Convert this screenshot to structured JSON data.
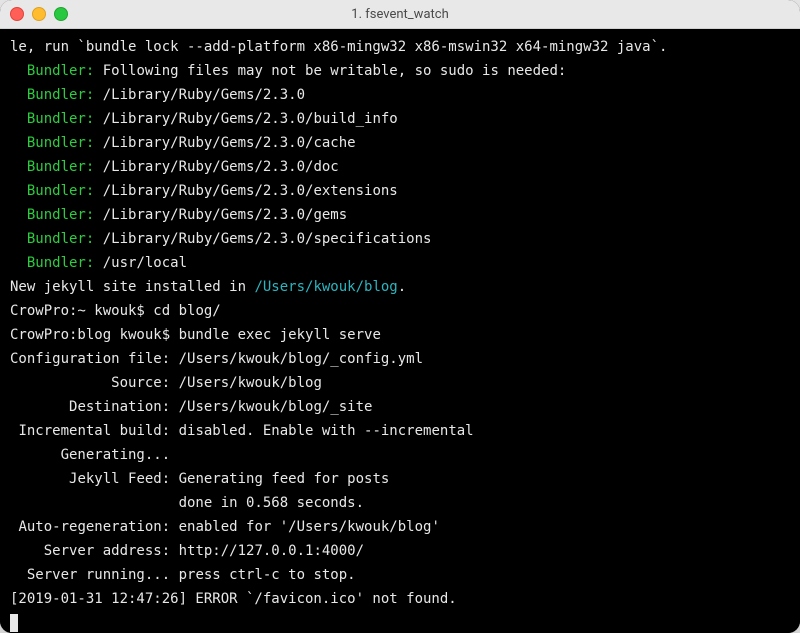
{
  "window": {
    "title": "1. fsevent_watch"
  },
  "colors": {
    "bundler_label": "#2ecc40",
    "cyan_path": "#2cb5c0",
    "fg": "#e8e8e8",
    "bg": "#000000"
  },
  "terminal": {
    "wrap_line": "le, run `bundle lock --add-platform x86-mingw32 x86-mswin32 x64-mingw32 java`.",
    "bundler_intro": "Following files may not be writable, so sudo is needed:",
    "bundler_label": "Bundler:",
    "bundler_paths": [
      "/Library/Ruby/Gems/2.3.0",
      "/Library/Ruby/Gems/2.3.0/build_info",
      "/Library/Ruby/Gems/2.3.0/cache",
      "/Library/Ruby/Gems/2.3.0/doc",
      "/Library/Ruby/Gems/2.3.0/extensions",
      "/Library/Ruby/Gems/2.3.0/gems",
      "/Library/Ruby/Gems/2.3.0/specifications",
      "/usr/local"
    ],
    "install_prefix": "New jekyll site installed in ",
    "install_path": "/Users/kwouk/blog",
    "install_suffix": ".",
    "prompt1": "CrowPro:~ kwouk$ ",
    "cmd1": "cd blog/",
    "prompt2": "CrowPro:blog kwouk$ ",
    "cmd2": "bundle exec jekyll serve",
    "config_label": "Configuration file:",
    "config_value": "/Users/kwouk/blog/_config.yml",
    "source_label": "Source:",
    "source_value": "/Users/kwouk/blog",
    "dest_label": "Destination:",
    "dest_value": "/Users/kwouk/blog/_site",
    "incremental_label": "Incremental build:",
    "incremental_value": "disabled. Enable with --incremental",
    "generating_label": "Generating...",
    "feed_label": "Jekyll Feed:",
    "feed_value": "Generating feed for posts",
    "done_value": "done in 0.568 seconds.",
    "autoregen_label": "Auto-regeneration:",
    "autoregen_value": "enabled for '/Users/kwouk/blog'",
    "server_addr_label": "Server address:",
    "server_addr_value": "http://127.0.0.1:4000/",
    "server_running_label": "Server running...",
    "server_running_value": "press ctrl-c to stop.",
    "error_line": "[2019-01-31 12:47:26] ERROR `/favicon.ico' not found."
  }
}
